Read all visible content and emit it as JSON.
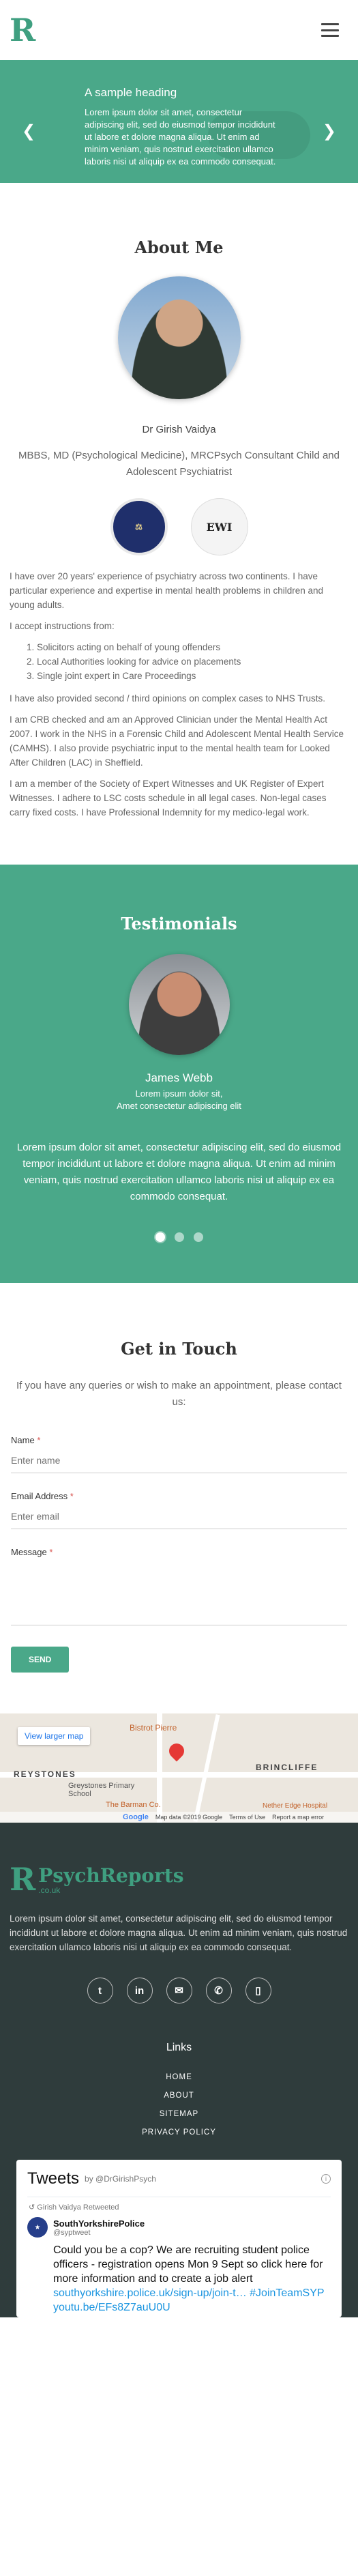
{
  "brand": {
    "logo_letter": "R",
    "footer_name": "PsychReports",
    "footer_suffix": ".co.uk",
    "accent": "#4aa889"
  },
  "hero": {
    "heading": "A sample heading",
    "text": "Lorem ipsum dolor sit amet, consectetur adipiscing elit, sed do eiusmod tempor incididunt ut labore et dolore magna aliqua. Ut enim ad minim veniam, quis nostrud exercitation ullamco laboris nisi ut aliquip ex ea commodo consequat.",
    "prev_icon": "chevron-left-icon",
    "next_icon": "chevron-right-icon"
  },
  "about": {
    "title": "About Me",
    "name": "Dr Girish Vaidya",
    "credentials": "MBBS, MD (Psychological Medicine), MRCPsych Consultant Child and Adolescent Psychiatrist",
    "badge_2": "EWI",
    "p1": "I have over 20 years' experience of psychiatry across two continents. I have particular experience and expertise in mental health problems in children and young adults.",
    "p2": "I accept instructions from:",
    "list": [
      "Solicitors acting on behalf of young offenders",
      "Local Authorities looking for advice on placements",
      "Single joint expert in Care Proceedings"
    ],
    "p3": "I have also provided second / third opinions on complex cases to NHS Trusts.",
    "p4": "I am CRB checked and am an Approved Clinician under the Mental Health Act 2007. I work in the NHS in a Forensic Child and Adolescent Mental Health Service (CAMHS). I also provide psychiatric input to the mental health team for Looked After Children (LAC) in Sheffield.",
    "p5": "I am a member of the Society of Expert Witnesses and UK Register of Expert Witnesses. I adhere to LSC costs schedule in all legal cases. Non-legal cases carry fixed costs. I have Professional Indemnity for my medico-legal work."
  },
  "testimonials": {
    "title": "Testimonials",
    "name": "James Webb",
    "role_1": "Lorem ipsum dolor sit,",
    "role_2": "Amet consectetur adipiscing elit",
    "quote": "Lorem ipsum dolor sit amet, consectetur adipiscing elit, sed do eiusmod tempor incididunt ut labore et dolore magna aliqua. Ut enim ad minim veniam, quis nostrud exercitation ullamco laboris nisi ut aliquip ex ea commodo consequat."
  },
  "contact": {
    "title": "Get in Touch",
    "intro": "If you have any queries or wish to make an appointment, please contact us:",
    "name_label": "Name",
    "name_placeholder": "Enter name",
    "email_label": "Email Address",
    "email_placeholder": "Enter email",
    "message_label": "Message",
    "required_mark": "*",
    "send_label": "SEND"
  },
  "map": {
    "view_larger": "View larger map",
    "label_1": "REYSTONES",
    "label_2": "BRINCLIFFE",
    "school": "Greystones Primary School",
    "bistro": "Bistrot Pierre",
    "barman": "The Barman Co.",
    "nether": "Nether Edge Hospital",
    "google": "Google",
    "map_data": "Map data ©2019 Google",
    "terms": "Terms of Use",
    "report": "Report a map error"
  },
  "footer": {
    "text": "Lorem ipsum dolor sit amet, consectetur adipiscing elit, sed do eiusmod tempor incididunt ut labore et dolore magna aliqua. Ut enim ad minim veniam, quis nostrud exercitation ullamco laboris nisi ut aliquip ex ea commodo consequat.",
    "social_icons": [
      "twitter-icon",
      "linkedin-icon",
      "email-icon",
      "phone-icon",
      "mobile-icon"
    ],
    "social_glyphs": [
      "t",
      "in",
      "✉",
      "✆",
      "▯"
    ],
    "links_title": "Links",
    "links": [
      "HOME",
      "ABOUT",
      "SITEMAP",
      "PRIVACY POLICY"
    ]
  },
  "tweets": {
    "title": "Tweets",
    "by": "by @DrGirishPsych",
    "retweet_note": "Girish Vaidya Retweeted",
    "user_name": "SouthYorkshirePolice",
    "user_handle": "@syptweet",
    "body": "Could you be a cop? We are recruiting student police officers - registration opens Mon 9 Sept so click here for more information and to create a job alert",
    "link": "southyorkshire.police.uk/sign-up/join-t…",
    "tag": "#JoinTeamSYP youtu.be/EFs8Z7auU0U"
  }
}
